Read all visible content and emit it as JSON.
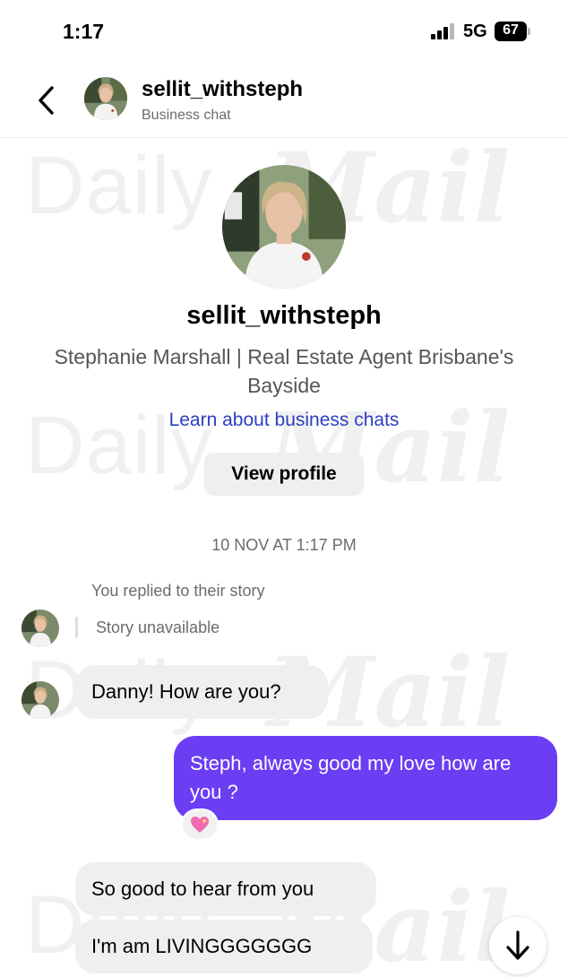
{
  "status_bar": {
    "time": "1:17",
    "network": "5G",
    "battery": "67"
  },
  "header": {
    "username": "sellit_withsteph",
    "subtitle": "Business chat",
    "back_icon": "chevron-left-icon"
  },
  "profile": {
    "username": "sellit_withsteph",
    "bio": "Stephanie Marshall | Real Estate Agent Brisbane's Bayside",
    "link": "Learn about business chats",
    "button": "View profile"
  },
  "chat": {
    "timestamp": "10 NOV AT 1:17 PM",
    "replied_note": "You replied to their story",
    "story_status": "Story unavailable",
    "messages": [
      {
        "from": "them",
        "text": "Danny! How are you?"
      },
      {
        "from": "me",
        "text": "Steph, always good my love how are you ?"
      },
      {
        "from": "them",
        "text": "So good to hear from you"
      },
      {
        "from": "them",
        "text": "I'm am LIVINGGGGGGG"
      }
    ],
    "reaction": "sparkling-heart-icon"
  },
  "watermark": {
    "brand_word_1": "Daily",
    "brand_word_2": "Mail"
  },
  "colors": {
    "outgoing_bubble": "#6b3df3",
    "incoming_bubble": "#efefef",
    "link": "#2c3fbf"
  }
}
